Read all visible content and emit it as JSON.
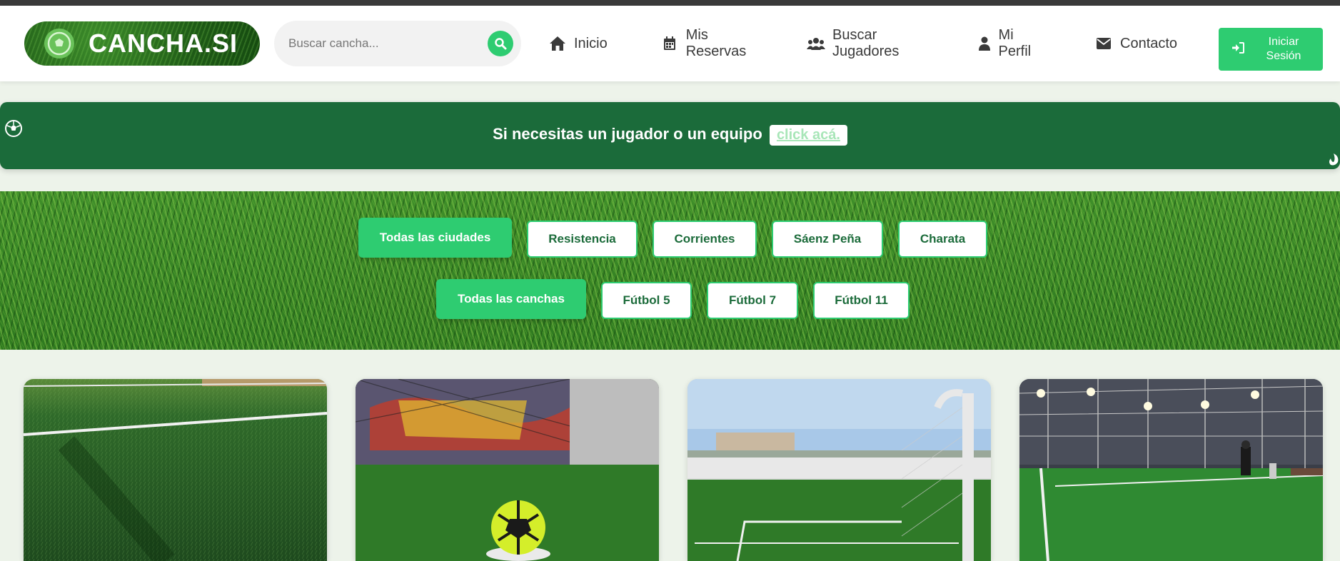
{
  "header": {
    "logo_text": "CANCHA.SI",
    "search": {
      "placeholder": "Buscar cancha..."
    },
    "nav": [
      {
        "label": "Inicio",
        "icon": "home-icon"
      },
      {
        "label": "Mis Reservas",
        "icon": "calendar-icon"
      },
      {
        "label": "Buscar Jugadores",
        "icon": "users-icon"
      },
      {
        "label": "Mi Perfil",
        "icon": "user-icon"
      },
      {
        "label": "Contacto",
        "icon": "envelope-icon"
      }
    ],
    "login_label": "Iniciar Sesión"
  },
  "banner": {
    "text": "Si necesitas un jugador o un equipo",
    "link": "click acá."
  },
  "filters": {
    "cities": [
      "Todas las ciudades",
      "Resistencia",
      "Corrientes",
      "Sáenz Peña",
      "Charata"
    ],
    "fields": [
      "Todas las canchas",
      "Fútbol 5",
      "Fútbol 7",
      "Fútbol 11"
    ]
  },
  "colors": {
    "accent": "#2ecc71",
    "banner": "#1b6b3a",
    "topbar": "#3a3a3a"
  }
}
